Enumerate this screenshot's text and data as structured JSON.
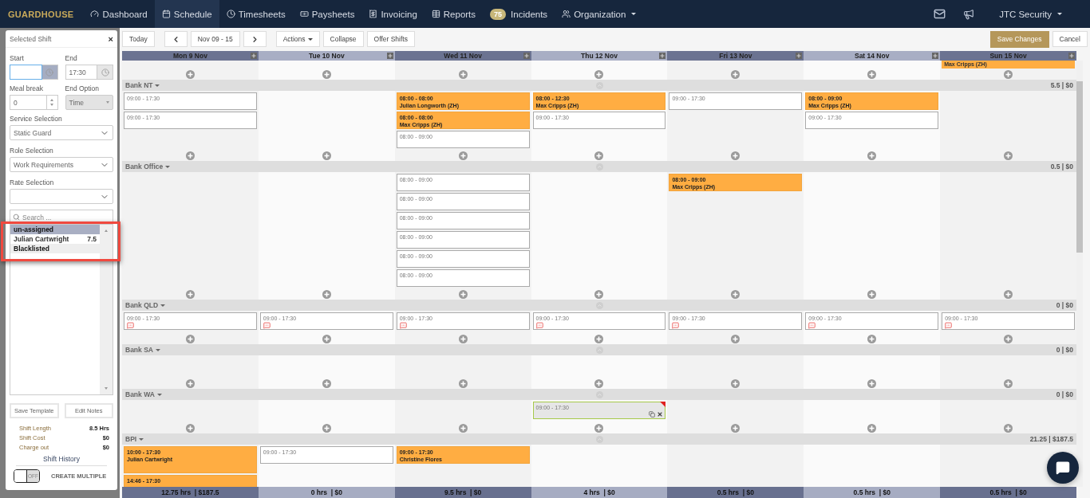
{
  "nav": {
    "logo": "GUARDHOUSE",
    "items": [
      {
        "label": "Dashboard",
        "selected": false
      },
      {
        "label": "Schedule",
        "selected": true
      },
      {
        "label": "Timesheets",
        "selected": false
      },
      {
        "label": "Paysheets",
        "selected": false
      },
      {
        "label": "Invoicing",
        "selected": false
      },
      {
        "label": "Reports",
        "selected": false
      },
      {
        "label": "Incidents",
        "selected": false,
        "badge": "75"
      },
      {
        "label": "Organization",
        "selected": false,
        "dropdown": true
      }
    ],
    "user": "JTC Security"
  },
  "toolbar": {
    "today": "Today",
    "range": "Nov 09 - 15",
    "actions": "Actions",
    "collapse": "Collapse",
    "offer": "Offer Shifts",
    "save": "Save Changes",
    "cancel": "Cancel"
  },
  "sidebar": {
    "title": "Selected Shift",
    "close": "×",
    "start": {
      "label": "Start"
    },
    "end": {
      "label": "End",
      "value": "17:30"
    },
    "meal": {
      "label": "Meal break",
      "value": "0"
    },
    "end_option": {
      "label": "End Option",
      "value": "Time",
      "disabled": true
    },
    "service": {
      "label": "Service Selection",
      "value": "Static Guard"
    },
    "role": {
      "label": "Role Selection",
      "value": "Work Requirements"
    },
    "rate": {
      "label": "Rate Selection"
    },
    "search": {
      "placeholder": "Search ..."
    },
    "list": [
      {
        "kind": "group",
        "name": "un-assigned"
      },
      {
        "kind": "person",
        "name": "Julian Cartwright",
        "hours": "7.5"
      },
      {
        "kind": "group",
        "name": "Blacklisted"
      }
    ],
    "buttons": [
      "Save Template",
      "Edit Notes"
    ],
    "stats": [
      {
        "label": "Shift Length",
        "value": "8.5 Hrs"
      },
      {
        "label": "Shift Cost",
        "value": "$0"
      },
      {
        "label": "Charge out",
        "value": "$0"
      }
    ],
    "history": "Shift History",
    "toggle": {
      "on": false,
      "label": "OFF"
    },
    "create_multiple": "CREATE MULTIPLE"
  },
  "calendar": {
    "days": [
      {
        "label": "Mon 9 Nov"
      },
      {
        "label": "Tue 10 Nov"
      },
      {
        "label": "Wed 11 Nov"
      },
      {
        "label": "Thu 12 Nov"
      },
      {
        "label": "Fri 13 Nov"
      },
      {
        "label": "Sat 14 Nov"
      },
      {
        "label": "Sun 15 Nov",
        "top_shift": {
          "kind": "assigned",
          "name": "Max Cripps (ZH)"
        }
      }
    ],
    "groups": [
      {
        "name": "Bank NT",
        "total": "5.5 | $0",
        "cells": [
          [
            {
              "kind": "open",
              "time": "09:00 - 17:30"
            },
            {
              "kind": "open",
              "time": "09:00 - 17:30"
            }
          ],
          [],
          [
            {
              "kind": "assigned",
              "time": "08:00 - 08:00",
              "name": "Julian Longworth (ZH)"
            },
            {
              "kind": "assigned",
              "time": "08:00 - 08:00",
              "name": "Max Cripps (ZH)"
            },
            {
              "kind": "open",
              "time": "08:00 - 09:00"
            }
          ],
          [
            {
              "kind": "assigned",
              "time": "08:00 - 12:30",
              "name": "Max Cripps (ZH)"
            },
            {
              "kind": "open",
              "time": "09:00 - 17:30"
            }
          ],
          [
            {
              "kind": "open",
              "time": "09:00 - 17:30"
            }
          ],
          [
            {
              "kind": "assigned",
              "time": "08:00 - 09:00",
              "name": "Max Cripps (ZH)"
            },
            {
              "kind": "open",
              "time": "09:00 - 17:30"
            }
          ],
          []
        ]
      },
      {
        "name": "Bank Office",
        "total": "0.5 | $0",
        "cells": [
          [],
          [],
          [
            {
              "kind": "open",
              "time": "08:00 - 09:00"
            },
            {
              "kind": "open",
              "time": "08:00 - 09:00"
            },
            {
              "kind": "open",
              "time": "08:00 - 09:00"
            },
            {
              "kind": "open",
              "time": "08:00 - 09:00"
            },
            {
              "kind": "open",
              "time": "08:00 - 09:00"
            },
            {
              "kind": "open",
              "time": "08:00 - 09:00"
            }
          ],
          [],
          [
            {
              "kind": "assigned",
              "time": "08:00 - 09:00",
              "name": "Max Cripps (ZH)"
            }
          ],
          [],
          []
        ]
      },
      {
        "name": "Bank QLD",
        "total": "0 | $0",
        "cells": [
          [
            {
              "kind": "open",
              "time": "09:00 - 17:30",
              "note": true
            }
          ],
          [
            {
              "kind": "open",
              "time": "09:00 - 17:30",
              "note": true
            }
          ],
          [
            {
              "kind": "open",
              "time": "09:00 - 17:30",
              "note": true
            }
          ],
          [
            {
              "kind": "open",
              "time": "09:00 - 17:30",
              "note": true
            }
          ],
          [
            {
              "kind": "open",
              "time": "09:00 - 17:30",
              "note": true
            }
          ],
          [
            {
              "kind": "open",
              "time": "09:00 - 17:30",
              "note": true
            }
          ],
          [
            {
              "kind": "open",
              "time": "09:00 - 17:30",
              "note": true
            }
          ]
        ]
      },
      {
        "name": "Bank SA",
        "total": "0 | $0",
        "cells": [
          [],
          [],
          [],
          [],
          [],
          [],
          []
        ]
      },
      {
        "name": "Bank WA",
        "total": "0 | $0",
        "cells": [
          [],
          [],
          [],
          [
            {
              "kind": "selected",
              "time": "09:00 - 17:30"
            }
          ],
          [],
          [],
          []
        ]
      },
      {
        "name": "BPI",
        "total": "21.25 | $187.5",
        "cells": [
          [
            {
              "kind": "assigned",
              "time": "10:00 - 17:30",
              "name": "Julian Cartwright",
              "tall": true
            },
            {
              "kind": "assigned",
              "time": "14:46 - 17:30"
            }
          ],
          [
            {
              "kind": "open",
              "time": "09:00 - 17:30"
            }
          ],
          [
            {
              "kind": "assigned",
              "time": "09:00 - 17:30",
              "name": "Christine Flores"
            }
          ],
          [],
          [],
          [],
          []
        ]
      }
    ],
    "totals": [
      "12.75 hrs  | $187.5",
      "0 hrs  | $0",
      "9.5 hrs  | $0",
      "4 hrs  | $0",
      "0.5 hrs  | $0",
      "0.5 hrs  | $0",
      "0.5 hrs  | $0"
    ]
  }
}
